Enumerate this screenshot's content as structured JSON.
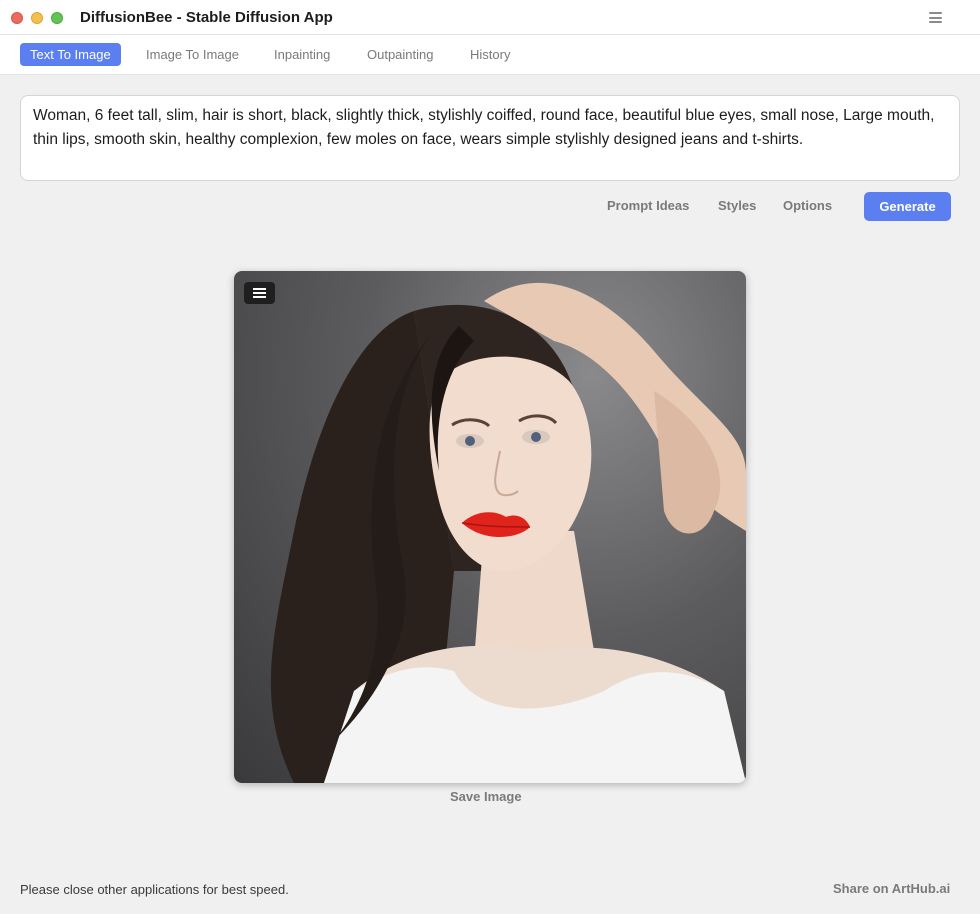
{
  "window": {
    "title": "DiffusionBee - Stable Diffusion App",
    "menu_icon": "hamburger-icon"
  },
  "tabs": [
    {
      "label": "Text To Image",
      "active": true
    },
    {
      "label": "Image To Image",
      "active": false
    },
    {
      "label": "Inpainting",
      "active": false
    },
    {
      "label": "Outpainting",
      "active": false
    },
    {
      "label": "History",
      "active": false
    }
  ],
  "prompt": {
    "value": "Woman, 6 feet tall, slim, hair is short, black, slightly thick, stylishly coiffed,  round face, beautiful blue eyes, small nose, Large mouth, thin lips, smooth skin, healthy complexion, few moles on face, wears simple stylishly designed jeans and t-shirts."
  },
  "controls": {
    "prompt_ideas": "Prompt Ideas",
    "styles": "Styles",
    "options": "Options",
    "generate": "Generate"
  },
  "result": {
    "menu_icon": "hamburger-icon",
    "save_label": "Save Image"
  },
  "footer": {
    "note": "Please close other applications for best speed.",
    "share": "Share on ArtHub.ai"
  },
  "colors": {
    "accent": "#5b7ff0",
    "background": "#f0f0f0",
    "muted_text": "#7a7a7a"
  }
}
